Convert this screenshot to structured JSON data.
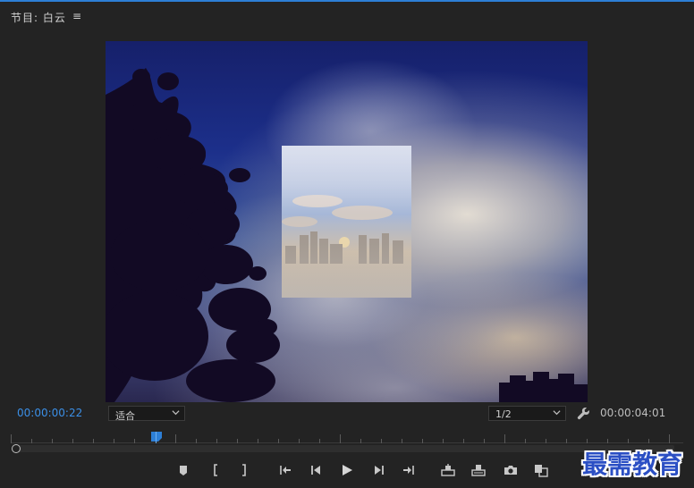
{
  "panel": {
    "title": "节目: 白云",
    "menu_glyph": "≡"
  },
  "timecode": {
    "current": "00:00:00:22",
    "duration": "00:00:04:01"
  },
  "zoom_dropdown": {
    "value": "适合"
  },
  "resolution_dropdown": {
    "value": "1/2"
  },
  "colors": {
    "accent": "#3b8fe6",
    "playhead": "#2d7fd6",
    "background": "#232323"
  },
  "icons": {
    "panel_menu": "hamburger-icon",
    "settings": "wrench-icon",
    "marker": "add-marker-icon",
    "mark_in": "mark-in-icon",
    "mark_out": "mark-out-icon",
    "go_to_in": "go-to-in-icon",
    "step_back": "step-back-icon",
    "play": "play-icon",
    "step_forward": "step-forward-icon",
    "go_to_out": "go-to-out-icon",
    "lift": "lift-icon",
    "extract": "extract-icon",
    "export_frame": "camera-icon",
    "comparison": "comparison-view-icon",
    "add_button": "plus-icon"
  },
  "watermark": {
    "text": "最需教育"
  },
  "add_button": {
    "label": "+"
  }
}
